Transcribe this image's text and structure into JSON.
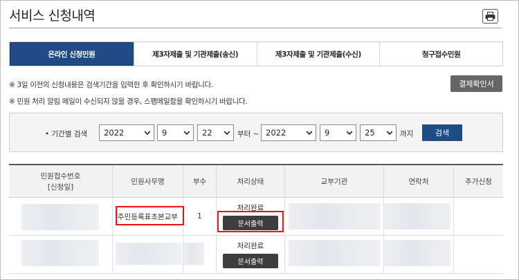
{
  "page_title": "서비스 신청내역",
  "tabs": [
    {
      "label": "온라인 신청민원",
      "active": true
    },
    {
      "label": "제3자제출 및 기관제출(송신)",
      "active": false
    },
    {
      "label": "제3자제출 및 기관제출(수신)",
      "active": false
    },
    {
      "label": "청구접수민원",
      "active": false
    }
  ],
  "notices": [
    "※ 3일 이전의 신청내용은 검색기간을 입력한 후 확인하시기 바랍니다.",
    "※ 민원 처리 알림 메일이 수신되지 않을 경우, 스팸메일함을 확인하시기 바랍니다."
  ],
  "receipt_button": "결제확인서",
  "search": {
    "label": "• 기간별 검색",
    "from_year": "2022",
    "from_month": "9",
    "from_day": "22",
    "from_suffix": "부터 ~",
    "to_year": "2022",
    "to_month": "9",
    "to_day": "25",
    "to_suffix": "까지",
    "button": "검색"
  },
  "table": {
    "headers": {
      "receipt_no_line1": "민원접수번호",
      "receipt_no_line2": "[신청일]",
      "affair": "민원사무명",
      "copies": "부수",
      "status": "처리상태",
      "issuing_org": "교부기관",
      "contact": "연락처",
      "extra": "추가신청"
    },
    "rows": [
      {
        "affair": "주민등록표초본교부",
        "copies": "1",
        "status": "처리완료",
        "doc_button": "문서출력"
      },
      {
        "affair": "",
        "copies": "",
        "status": "처리완료",
        "doc_button": "문서출력"
      }
    ]
  },
  "colors": {
    "primary": "#1f4b86",
    "highlight": "#e11111",
    "dark_button": "#3d3d3d"
  }
}
